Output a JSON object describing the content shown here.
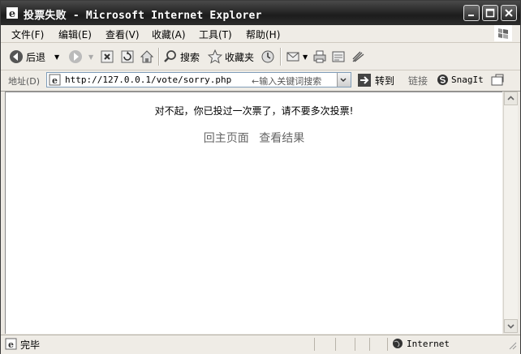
{
  "window": {
    "title": "投票失败 - Microsoft Internet Explorer"
  },
  "menu": {
    "items": [
      "文件(F)",
      "编辑(E)",
      "查看(V)",
      "收藏(A)",
      "工具(T)",
      "帮助(H)"
    ]
  },
  "toolbar": {
    "back_label": "后退",
    "search_label": "搜索",
    "favorites_label": "收藏夹"
  },
  "address": {
    "label": "地址(D)",
    "url": "http://127.0.0.1/vote/sorry.php",
    "hint": "←输入关键词搜索",
    "go_label": "转到",
    "links_label": "链接",
    "snagit_label": "SnagIt"
  },
  "page": {
    "message": "对不起，你已投过一次票了，请不要多次投票!",
    "home_link": "回主页面",
    "results_link": "查看结果"
  },
  "status": {
    "text": "完毕",
    "zone": "Internet"
  }
}
